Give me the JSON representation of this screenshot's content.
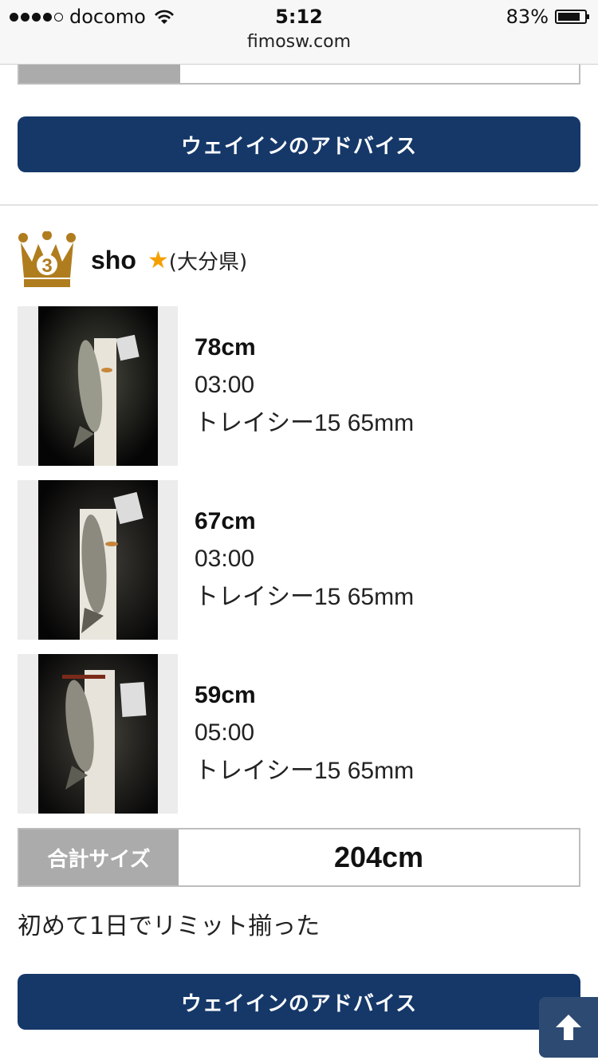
{
  "status_bar": {
    "carrier": "docomo",
    "time": "5:12",
    "battery": "83%",
    "battery_level": 0.83,
    "url": "fimosw.com"
  },
  "buttons": {
    "advice_label": "ウェイインのアドバイス"
  },
  "entry": {
    "rank": "3",
    "username": "sho",
    "star": "★",
    "prefecture": "(大分県)",
    "catches": [
      {
        "size": "78cm",
        "time": "03:00",
        "lure": "トレイシー15 65mm"
      },
      {
        "size": "67cm",
        "time": "03:00",
        "lure": "トレイシー15 65mm"
      },
      {
        "size": "59cm",
        "time": "05:00",
        "lure": "トレイシー15 65mm"
      }
    ],
    "total_label": "合計サイズ",
    "total_value": "204cm",
    "comment": "初めて1日でリミット揃った"
  },
  "colors": {
    "primary_button": "#153869",
    "label_gray": "#ababab",
    "crown_gold": "#b07d1e",
    "star": "#f5a000"
  },
  "icons": [
    "wifi-icon",
    "battery-icon",
    "crown-rank-icon",
    "star-icon",
    "arrow-up-icon"
  ]
}
